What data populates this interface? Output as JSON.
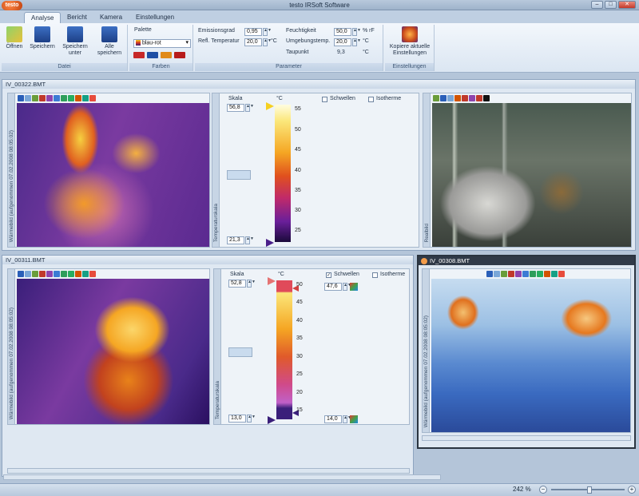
{
  "window": {
    "title": "testo IRSoft Software",
    "logo": "testo"
  },
  "tabs": [
    "Analyse",
    "Bericht",
    "Kamera",
    "Einstellungen"
  ],
  "ribbon": {
    "datei": {
      "label": "Datei",
      "open": "Öffnen",
      "save": "Speichern",
      "save_as": "Speichern unter",
      "save_all": "Alle speichern"
    },
    "farben": {
      "label": "Farben",
      "palette_label": "Palette",
      "palette_value": "blau-rot"
    },
    "parameter": {
      "label": "Parameter",
      "emission_label": "Emissionsgrad",
      "emission_value": "0,95",
      "refl_label": "Refl. Temperatur",
      "refl_value": "20,0",
      "refl_unit": "°C",
      "humidity_label": "Feuchtigkeit",
      "humidity_value": "50,0",
      "humidity_unit": "% rF",
      "ambient_label": "Umgebungstemp.",
      "ambient_value": "20,0",
      "ambient_unit": "°C",
      "dew_label": "Taupunkt",
      "dew_value": "9,3",
      "dew_unit": "°C"
    },
    "einstellungen": {
      "label": "Einstellungen",
      "copy": "Kopiere aktuelle Einstellungen"
    }
  },
  "doc1": {
    "title": "IV_00322.BMT",
    "ir_label": "Wärmebild (aufgenommen 07.02.2008 08:05:02)",
    "scale_tab": "Temperaturskala",
    "real_tab": "Realbild",
    "scale_label": "Skala",
    "unit": "°C",
    "max": "56,8",
    "min": "21,3",
    "threshold_label": "Schwellen",
    "isotherm_label": "Isotherme",
    "ticks": [
      "55",
      "50",
      "45",
      "40",
      "35",
      "30",
      "25"
    ]
  },
  "doc2": {
    "title": "IV_00311.BMT",
    "ir_label": "Wärmebild (aufgenommen 07.02.2008 08:05:02)",
    "scale_tab": "Temperaturskala",
    "scale_label": "Skala",
    "unit": "°C",
    "max": "52,8",
    "min": "13,0",
    "threshold_label": "Schwellen",
    "isotherm_label": "Isotherme",
    "thr_upper": "47,6",
    "thr_lower": "14,0",
    "ticks": [
      "50",
      "45",
      "40",
      "35",
      "30",
      "25",
      "20",
      "15"
    ],
    "scroll": "III"
  },
  "doc3": {
    "title": "IV_00308.BMT",
    "ir_label": "Wärmebild (aufgenommen 07.02.2008 08:05:02)",
    "scroll": "III"
  },
  "workspace": {
    "scroll": "III"
  },
  "status": {
    "zoom": "242 %"
  }
}
